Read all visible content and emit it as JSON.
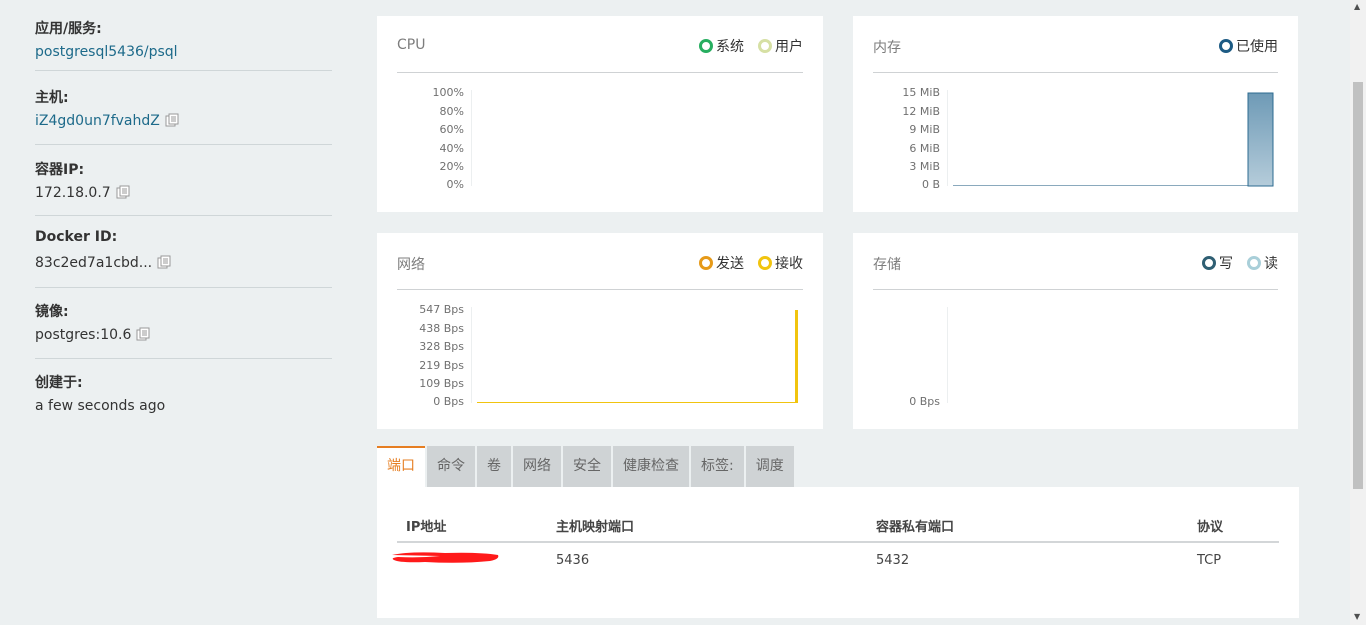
{
  "sidebar": {
    "app_service_label": "应用/服务:",
    "app_service_value": "postgresql5436/psql",
    "host_label": "主机:",
    "host_value": "iZ4gd0un7fvahdZ",
    "container_ip_label": "容器IP:",
    "container_ip_value": "172.18.0.7",
    "docker_id_label": "Docker ID:",
    "docker_id_value": "83c2ed7a1cbd...",
    "image_label": "镜像:",
    "image_value": "postgres:10.6",
    "created_label": "创建于:",
    "created_value": "a few seconds ago",
    "copy_icon": "copy-icon"
  },
  "cpu_card": {
    "title": "CPU",
    "legend": [
      {
        "label": "系统",
        "color": "#27ae60"
      },
      {
        "label": "用户",
        "color": "#d6e0a4"
      }
    ],
    "yticks": [
      "100%",
      "80%",
      "60%",
      "40%",
      "20%",
      "0%"
    ]
  },
  "memory_card": {
    "title": "内存",
    "legend": [
      {
        "label": "已使用",
        "color": "#1d5b84"
      }
    ],
    "yticks": [
      "15 MiB",
      "12 MiB",
      "9 MiB",
      "6 MiB",
      "3 MiB",
      "0 B"
    ]
  },
  "network_card": {
    "title": "网络",
    "legend": [
      {
        "label": "发送",
        "color": "#e69a19"
      },
      {
        "label": "接收",
        "color": "#f1c40f"
      }
    ],
    "yticks": [
      "547 Bps",
      "438 Bps",
      "328 Bps",
      "219 Bps",
      "109 Bps",
      "0 Bps"
    ]
  },
  "storage_card": {
    "title": "存储",
    "legend": [
      {
        "label": "写",
        "color": "#2f5f73"
      },
      {
        "label": "读",
        "color": "#a9cfd9"
      }
    ],
    "yticks": [
      "0 Bps"
    ]
  },
  "tabs": [
    {
      "label": "端口",
      "active": true
    },
    {
      "label": "命令",
      "active": false
    },
    {
      "label": "卷",
      "active": false
    },
    {
      "label": "网络",
      "active": false
    },
    {
      "label": "安全",
      "active": false
    },
    {
      "label": "健康检查",
      "active": false
    },
    {
      "label": "标签:",
      "active": false
    },
    {
      "label": "调度",
      "active": false
    }
  ],
  "ports_table": {
    "headers": [
      "IP地址",
      "主机映射端口",
      "容器私有端口",
      "协议"
    ],
    "rows": [
      {
        "ip": "",
        "host_port": "5436",
        "container_port": "5432",
        "protocol": "TCP"
      }
    ]
  },
  "colors": {
    "accent": "#e67e22",
    "link": "#1d6a8a",
    "memory_bar_top": "#6e9ab6",
    "memory_bar_bottom": "#b5ccda",
    "network_line": "#f1c40f",
    "redaction": "#ff0000"
  }
}
